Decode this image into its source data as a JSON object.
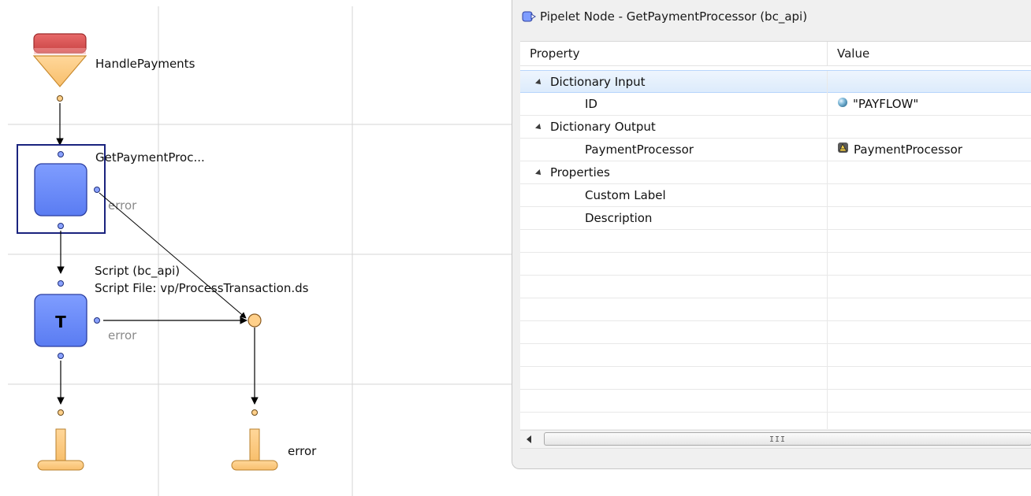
{
  "diagram": {
    "start_node_label": "HandlePayments",
    "pipelet_node_label": "GetPaymentProc...",
    "pipelet_error_label": "error",
    "script_node_line1": "Script (bc_api)",
    "script_node_line2": "Script File: vp/ProcessTransaction.ds",
    "script_node_glyph": "T",
    "script_error_label": "error",
    "end_error_label": "error",
    "colors": {
      "node_blue": "#6b8cff",
      "selection_border": "#1a237e",
      "start_red": "#d9534f",
      "start_orange": "#fdc97a",
      "connector_blue": "#8aa2ff",
      "connector_orange": "#ffd08a"
    }
  },
  "panel": {
    "title": "Pipelet Node - GetPaymentProcessor (bc_api)",
    "title_icon": "pipelet-node-icon",
    "columns": {
      "property": "Property",
      "value": "Value"
    },
    "rows": [
      {
        "property": "Dictionary Input",
        "value": "",
        "group": true,
        "selected": true
      },
      {
        "property": "ID",
        "value": "\"PAYFLOW\"",
        "value_icon": "string-constant-icon"
      },
      {
        "property": "Dictionary Output",
        "value": "",
        "group": true
      },
      {
        "property": "PaymentProcessor",
        "value": "PaymentProcessor",
        "value_icon": "object-icon"
      },
      {
        "property": "Properties",
        "value": "",
        "group": true
      },
      {
        "property": "Custom Label",
        "value": ""
      },
      {
        "property": "Description",
        "value": ""
      }
    ],
    "scrollbar_grip": "III"
  }
}
